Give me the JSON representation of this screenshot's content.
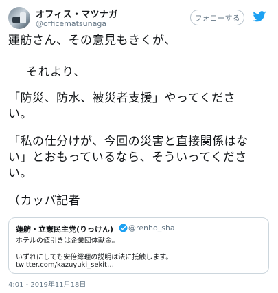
{
  "author": {
    "display_name": "オフィス・マツナガ",
    "handle": "@officematsunaga",
    "avatar_icon": "avatar-photo"
  },
  "follow_button": {
    "label": "フォローする"
  },
  "brand_icon": "twitter-bird-icon",
  "tweet": {
    "lines": [
      "蓮舫さん、その意見もきくが、",
      "それより、",
      "「防災、防水、被災者支援」やってくださ",
      "い。",
      "「私の仕分けが、今回の災害と直接関係はな",
      "い」とおもっているなら、そういってくださ",
      "い。",
      "（カッパ記者"
    ]
  },
  "quoted_tweet": {
    "display_name": "蓮舫・立憲民主党(りっけん)",
    "verified": true,
    "handle": "@renho_sha",
    "lines": [
      "ホテルの値引きは企業団体献金。",
      "いずれにしても安倍総理の説明は法に抵触します。",
      "twitter.com/kazuyuki_sekit…"
    ]
  },
  "timestamp": "4:01 - 2019年11月18日",
  "colors": {
    "text": "#14171a",
    "secondary": "#657786",
    "brand": "#1da1f2",
    "border": "#ccd6dd"
  }
}
